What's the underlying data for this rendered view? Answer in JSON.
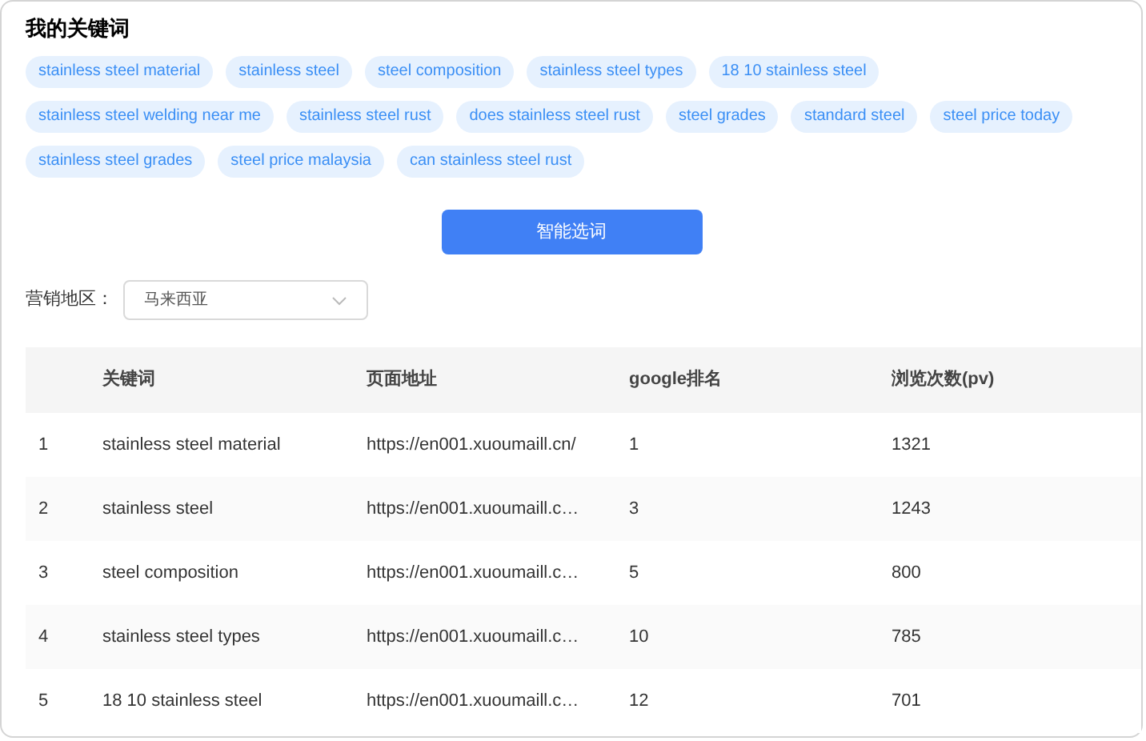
{
  "title": "我的关键词",
  "keywords": [
    "stainless steel material",
    "stainless steel",
    "steel composition",
    "stainless steel types",
    "18 10 stainless steel",
    "stainless steel welding near me",
    "stainless steel rust",
    "does stainless steel rust",
    "steel grades",
    "standard steel",
    "steel price today",
    "stainless steel grades",
    "steel price malaysia",
    "can stainless steel rust"
  ],
  "smart_button": "智能选词",
  "region": {
    "label": "营销地区：",
    "value": "马来西亚"
  },
  "table": {
    "columns": [
      "",
      "关键词",
      "页面地址",
      "google排名",
      "浏览次数(pv)"
    ],
    "rows": [
      [
        "1",
        "stainless steel material",
        "https://en001.xuoumaill.cn/",
        "1",
        "1321"
      ],
      [
        "2",
        "stainless steel",
        "https://en001.xuoumaill.c…",
        "3",
        "1243"
      ],
      [
        "3",
        "steel composition",
        "https://en001.xuoumaill.c…",
        "5",
        "800"
      ],
      [
        "4",
        "stainless steel types",
        "https://en001.xuoumaill.c…",
        "10",
        "785"
      ],
      [
        "5",
        "18 10 stainless steel",
        "https://en001.xuoumaill.c…",
        "12",
        "701"
      ]
    ]
  }
}
